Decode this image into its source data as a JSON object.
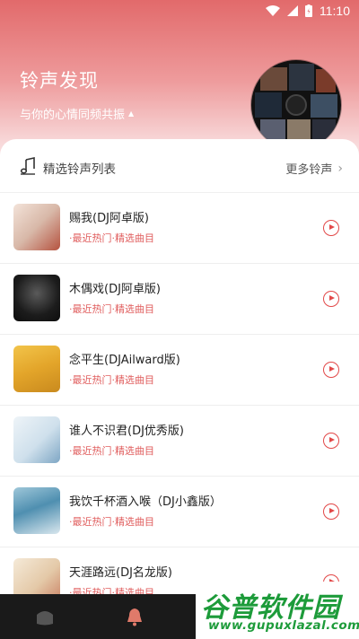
{
  "status": {
    "time": "11:10"
  },
  "hero": {
    "title": "铃声发现",
    "subtitle": "与你的心情同频共振"
  },
  "list_header": {
    "title": "精选铃声列表",
    "more": "更多铃声"
  },
  "songs": [
    {
      "title": "赐我(DJ阿卓版)",
      "tag": "·最近热门·精选曲目"
    },
    {
      "title": "木偶戏(DJ阿卓版)",
      "tag": "·最近热门·精选曲目"
    },
    {
      "title": "念平生(DJAilward版)",
      "tag": "·最近热门·精选曲目"
    },
    {
      "title": "谁人不识君(DJ优秀版)",
      "tag": "·最近热门·精选曲目"
    },
    {
      "title": "我饮千杯酒入喉（DJ小鑫版）",
      "tag": "·最近热门·精选曲目"
    },
    {
      "title": "天涯路远(DJ名龙版)",
      "tag": "·最近热门·精选曲目"
    }
  ],
  "watermark": {
    "brand": "谷普软件园",
    "url": "www.gupuxlazal.com"
  },
  "colors": {
    "accent": "#e24848",
    "tag": "#e05d5d",
    "hero_top": "#e26a6b"
  }
}
